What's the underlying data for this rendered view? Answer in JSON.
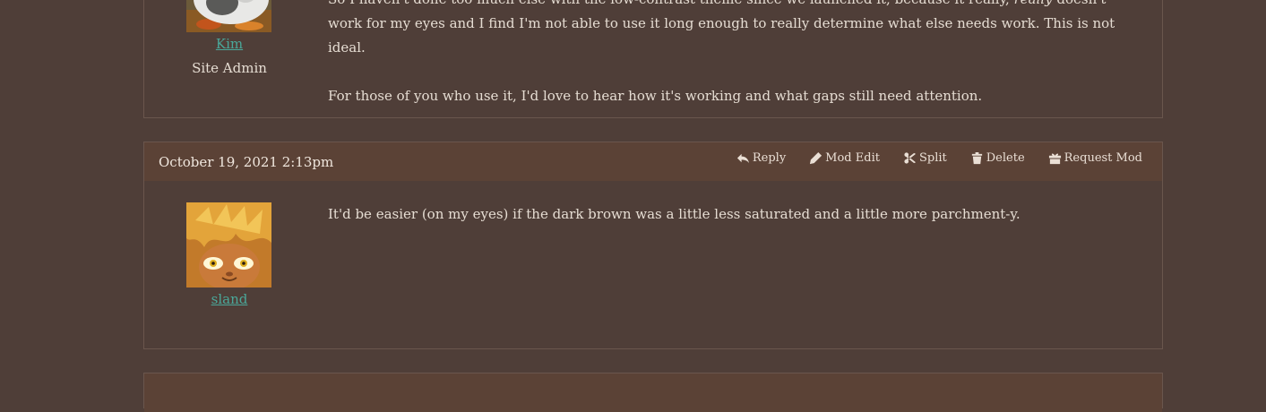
{
  "posts": [
    {
      "author": "Kim",
      "role": "Site Admin",
      "avatar_icon": "guinea-pig-avatar",
      "paragraph1_part1": "So I haven't done too much else with the low-contrast theme since we launched it, because it really, ",
      "paragraph1_emphasis": "really",
      "paragraph1_part2": " doesn't work for my eyes and I find I'm not able to use it long enough to really determine what else needs work. This is not ideal.",
      "paragraph2": "For those of you who use it, I'd love to hear how it's working and what gaps still need attention."
    },
    {
      "date": "October 19, 2021 2:13pm",
      "author": "sland",
      "avatar_icon": "cartoon-face-avatar",
      "text": "It'd be easier (on my eyes) if the dark brown was a little less saturated and a little more parchment-y."
    }
  ],
  "actions": {
    "reply": "Reply",
    "mod_edit": "Mod Edit",
    "split": "Split",
    "delete": "Delete",
    "request_mod": "Request Mod"
  },
  "colors": {
    "background": "#4f3e38",
    "header": "#5b4236",
    "link": "#4aa89a",
    "text": "#e6ddd3"
  }
}
